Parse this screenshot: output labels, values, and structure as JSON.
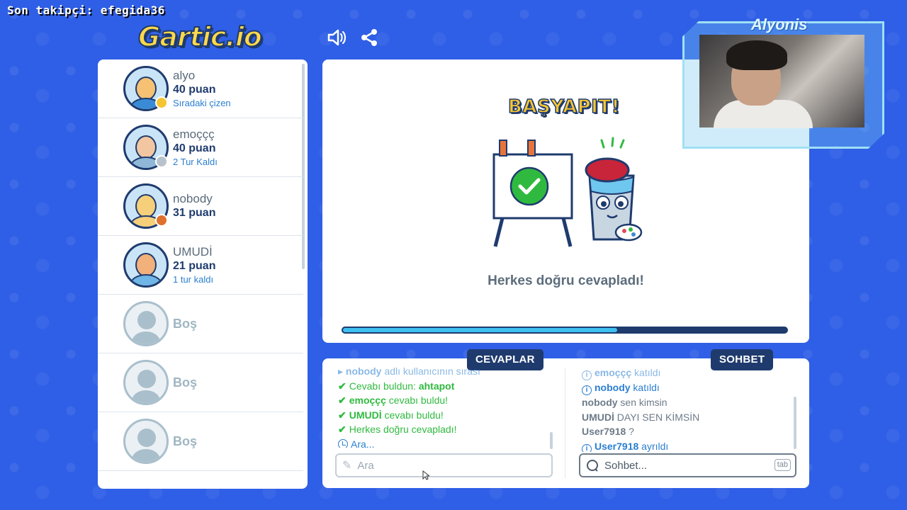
{
  "overlay": {
    "last_follower": "Son takipçi: efegida36",
    "streamer_name": "Alyonis"
  },
  "header": {
    "logo_text": "Gartic.io",
    "icons": [
      "speaker-icon",
      "share-icon"
    ]
  },
  "players": [
    {
      "name": "alyo",
      "score": "40 puan",
      "note": "Sıradaki çizen",
      "avatar_color": "#f6c173",
      "status_color": "#f5c531"
    },
    {
      "name": "emoççç",
      "score": "40 puan",
      "note": "2 Tur Kaldı",
      "avatar_color": "#f2c6a0",
      "status_color": "#b7c2cc"
    },
    {
      "name": "nobody",
      "score": "31 puan",
      "note": "",
      "avatar_color": "#f6cf7a",
      "status_color": "#e0712d"
    },
    {
      "name": "UMUDİ",
      "score": "21 puan",
      "note": "1 tur kaldı",
      "avatar_color": "#f2b07a",
      "status_color": ""
    },
    {
      "name": "Boş",
      "score": "",
      "note": "",
      "empty": true
    },
    {
      "name": "Boş",
      "score": "",
      "note": "",
      "empty": true
    },
    {
      "name": "Boş",
      "score": "",
      "note": "",
      "empty": true
    }
  ],
  "main": {
    "title": "BAŞYAPIT!",
    "message": "Herkes doğru cevapladı!",
    "progress": 0.62
  },
  "answers": {
    "tab_label": "CEVAPLAR",
    "messages": [
      {
        "prefix": "nobody",
        "text": "adlı kullanıcının sırası",
        "faded": true
      },
      {
        "text": "Cevabı buldun: ",
        "bold": "ahtapot"
      },
      {
        "bold": "emoççç",
        "text": " cevabı buldu!"
      },
      {
        "bold": "UMUDİ",
        "text": " cevabı buldu!"
      },
      {
        "text": "Herkes doğru cevapladı!"
      },
      {
        "text": "Ara..."
      }
    ],
    "input_placeholder": "Ara"
  },
  "chat": {
    "tab_label": "SOHBET",
    "messages": [
      {
        "bold": "emoççç",
        "text": " katıldı"
      },
      {
        "bold": "nobody",
        "text": " katıldı"
      },
      {
        "user": "nobody",
        "text": " sen kimsin"
      },
      {
        "user": "UMUDİ",
        "text": " DAYI SEN KİMSİN"
      },
      {
        "user": "User7918",
        "text": " ?"
      },
      {
        "bold": "User7918",
        "text": " ayrıldı"
      }
    ],
    "input_placeholder": "Sohbet...",
    "tab_hint": "tab"
  }
}
